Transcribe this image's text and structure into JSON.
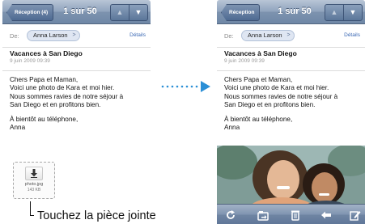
{
  "screens": {
    "left": {
      "nav": {
        "back_label": "Réception (4)",
        "title": "1 sur 50",
        "prev_icon": "▲",
        "next_icon": "▼"
      },
      "from_label": "De:",
      "sender": "Anna Larson",
      "chip_chevron": ">",
      "details_link": "Détails",
      "subject": "Vacances à San Diego",
      "date": "9 juin 2009 09:39",
      "body_lines_1": [
        "Chers Papa et Maman,",
        "Voici une photo de Kara et moi hier.",
        "Nous sommes ravies de notre séjour à",
        "San Diego et en profitons bien."
      ],
      "body_lines_2": [
        "À bientôt au téléphone,",
        "Anna"
      ],
      "attachment": {
        "name": "photo.jpg",
        "size": "143 KB"
      }
    },
    "right": {
      "nav": {
        "back_label": "Réception",
        "title": "1 sur 50",
        "prev_icon": "▲",
        "next_icon": "▼"
      },
      "from_label": "De:",
      "sender": "Anna Larson",
      "chip_chevron": ">",
      "details_link": "Détails",
      "subject": "Vacances à San Diego",
      "date": "9 juin 2009 09:39",
      "body_lines_1": [
        "Chers Papa et Maman,",
        "Voici une photo de Kara et moi hier.",
        "Nous sommes ravies de notre séjour à",
        "San Diego et en profitons bien."
      ],
      "body_lines_2": [
        "À bientôt au téléphone,",
        "Anna"
      ],
      "toolbar_icons": [
        "refresh-icon",
        "move-folder-icon",
        "trash-icon",
        "reply-icon",
        "compose-icon"
      ]
    }
  },
  "callout": {
    "text": "Touchez la pièce jointe"
  },
  "colors": {
    "nav_bar": "#7d93af",
    "link": "#3a68b4",
    "toolbar": "#6f85a3"
  }
}
